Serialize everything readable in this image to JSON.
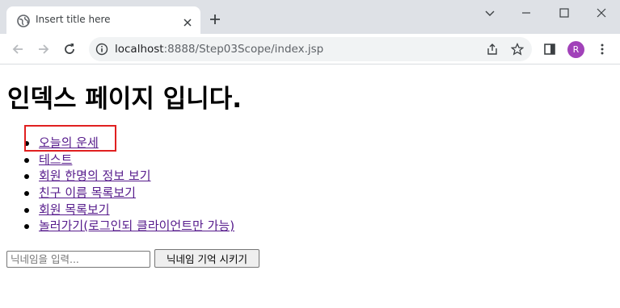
{
  "browser": {
    "tab_title": "Insert title here",
    "url_host": "localhost",
    "url_rest": ":8888/Step03Scope/index.jsp",
    "avatar_letter": "R",
    "avatar_color": "#a142b9"
  },
  "page": {
    "heading": "인덱스 페이지 입니다.",
    "links": [
      {
        "label": "오늘의 운세"
      },
      {
        "label": "테스트"
      },
      {
        "label": "회원 한명의 정보 보기"
      },
      {
        "label": "친구 이름 목록보기"
      },
      {
        "label": "회원 목록보기"
      },
      {
        "label": "놀러가기(로그인되 클라이언트만 가능)"
      }
    ],
    "nickname_placeholder": "닉네임을 입력...",
    "nickname_value": "",
    "nickname_button": "닉네임 기억 시키기",
    "link_color": "#551a8b",
    "highlight_color": "#e02020"
  }
}
